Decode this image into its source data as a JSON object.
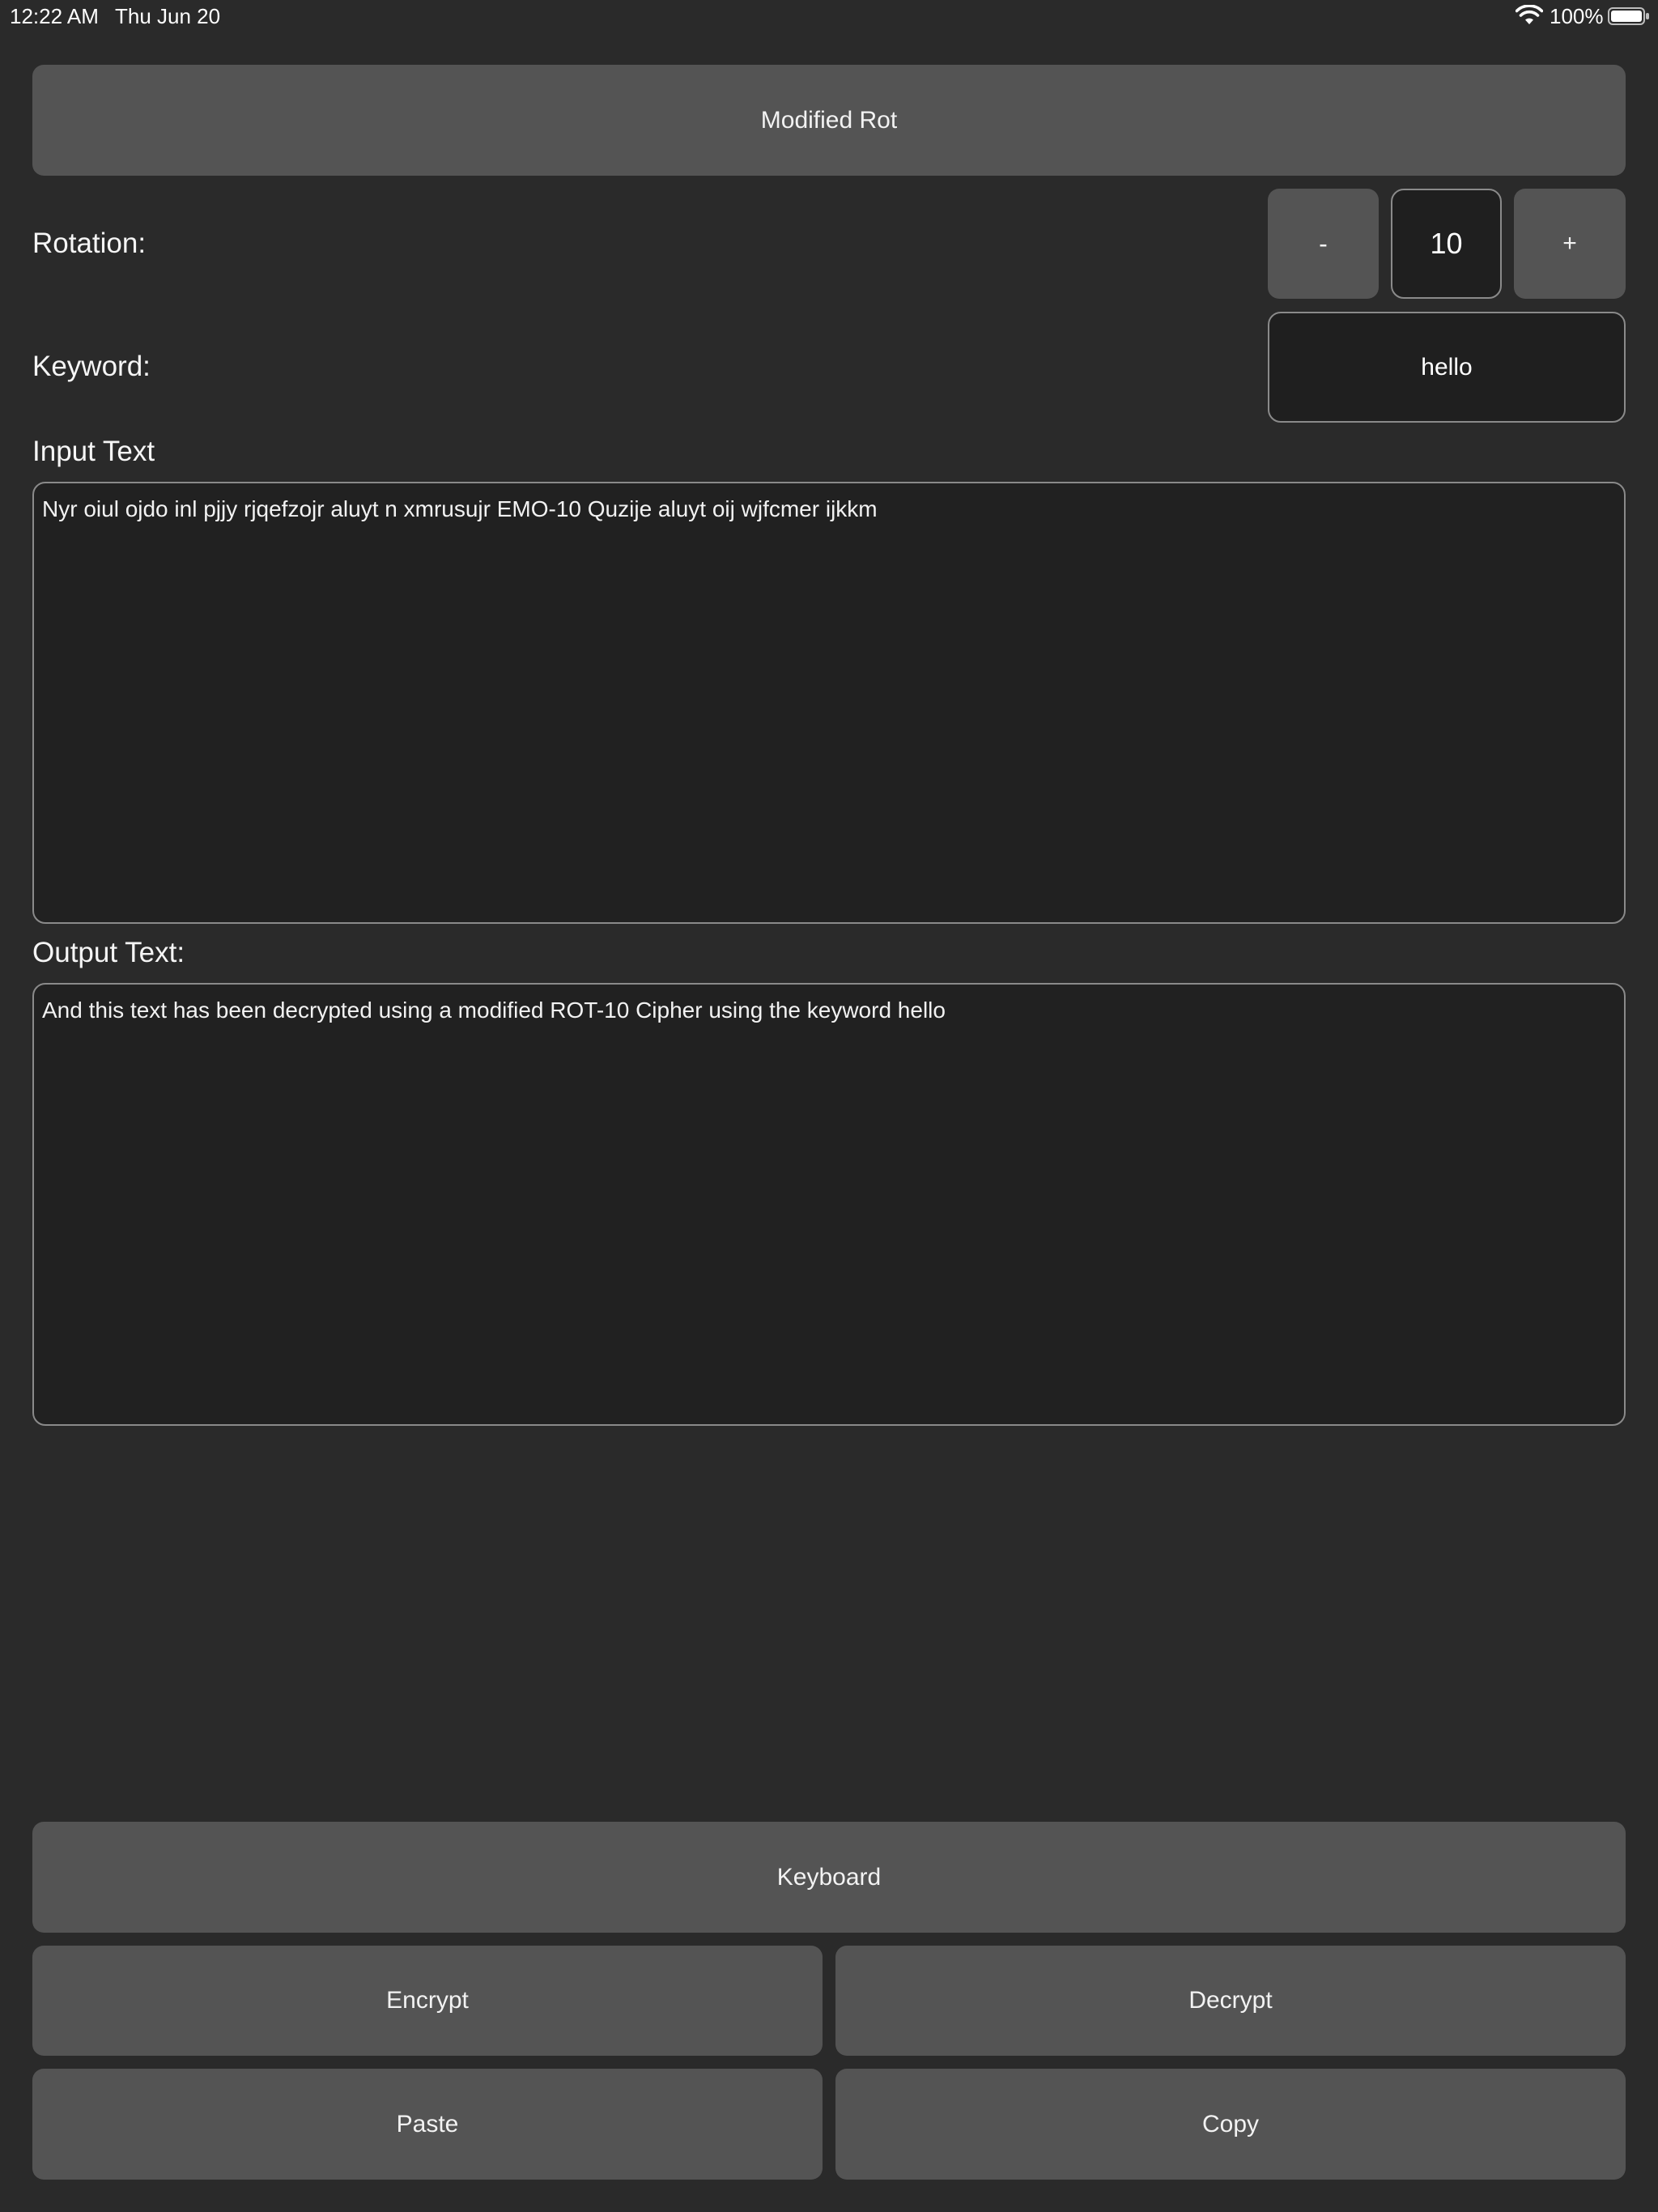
{
  "status_bar": {
    "time": "12:22 AM",
    "date": "Thu Jun 20",
    "battery_percent": "100%",
    "wifi_icon": "wifi-icon",
    "battery_icon": "battery-full-icon"
  },
  "mode_button": {
    "label": "Modified Rot"
  },
  "rotation": {
    "label": "Rotation:",
    "decrement_label": "-",
    "value": "10",
    "increment_label": "+"
  },
  "keyword": {
    "label": "Keyword:",
    "value": "hello"
  },
  "input": {
    "label": "Input Text",
    "text": "Nyr oiul ojdo inl pjjy rjqefzojr aluyt n xmrusujr EMO-10 Quzije aluyt oij wjfcmer ijkkm"
  },
  "output": {
    "label": "Output Text:",
    "text": "And this text has been decrypted using a modified ROT-10 Cipher using the keyword hello"
  },
  "actions": {
    "keyboard": "Keyboard",
    "encrypt": "Encrypt",
    "decrypt": "Decrypt",
    "paste": "Paste",
    "copy": "Copy"
  },
  "colors": {
    "background": "#2a2a2a",
    "button": "#545454",
    "field": "#1f1f1f",
    "border": "#8a8a8a",
    "text": "#ffffff"
  }
}
